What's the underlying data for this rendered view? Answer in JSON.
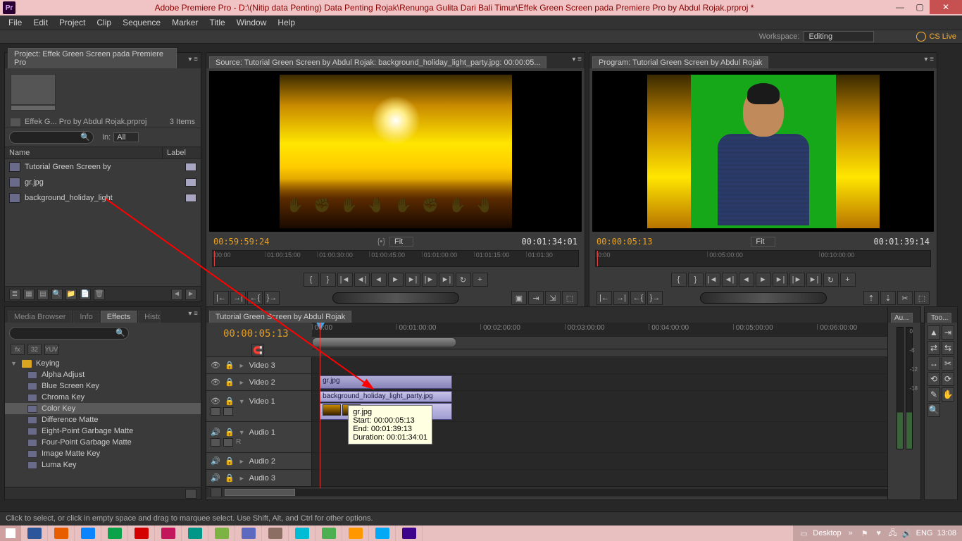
{
  "app": {
    "icon_label": "Pr",
    "title": "Adobe Premiere Pro - D:\\(Nitip data Penting) Data Penting Rojak\\Renunga Gulita Dari Bali Timur\\Effek Green Screen pada Premiere Pro by Abdul Rojak.prproj *"
  },
  "window_buttons": {
    "min": "—",
    "max": "▢",
    "close": "✕"
  },
  "menu": [
    "File",
    "Edit",
    "Project",
    "Clip",
    "Sequence",
    "Marker",
    "Title",
    "Window",
    "Help"
  ],
  "workspace": {
    "label": "Workspace:",
    "value": "Editing",
    "cslive": "CS Live"
  },
  "project_panel": {
    "tab": "Project: Effek Green Screen pada Premiere Pro",
    "file_line": "Effek G... Pro by Abdul Rojak.prproj",
    "item_count": "3 Items",
    "in_label": "In:",
    "in_value": "All",
    "cols": {
      "name": "Name",
      "label": "Label"
    },
    "rows": [
      {
        "name": "Tutorial Green Screen by"
      },
      {
        "name": "gr.jpg"
      },
      {
        "name": "background_holiday_light"
      }
    ]
  },
  "source_monitor": {
    "tab": "Source: Tutorial Green Screen by Abdul Rojak: background_holiday_light_party.jpg: 00:00:05...",
    "tc_left": "00:59:59:24",
    "fit": "Fit",
    "tc_right": "00:01:34:01",
    "ruler": [
      "00:00",
      "01:00:15:00",
      "01:00:30:00",
      "01:00:45:00",
      "01:01:00:00",
      "01:01:15:00",
      "01:01:30"
    ]
  },
  "program_monitor": {
    "tab": "Program: Tutorial Green Screen by Abdul Rojak",
    "tc_left": "00:00:05:13",
    "fit": "Fit",
    "tc_right": "00:01:39:14",
    "ruler": [
      "0:00",
      "00:05:00:00",
      "00:10:00:00"
    ]
  },
  "lower_tabs": {
    "tabs": [
      "Media Browser",
      "Info",
      "Effects",
      "History"
    ],
    "active": "Effects",
    "folder": "Keying",
    "items": [
      "Alpha Adjust",
      "Blue Screen Key",
      "Chroma Key",
      "Color Key",
      "Difference Matte",
      "Eight-Point Garbage Matte",
      "Four-Point Garbage Matte",
      "Image Matte Key",
      "Luma Key"
    ],
    "selected": "Color Key",
    "icons": [
      "fx",
      "32",
      "YUV"
    ]
  },
  "timeline": {
    "tab": "Tutorial Green Screen by Abdul Rojak",
    "playhead_tc": "00:00:05:13",
    "ruler": [
      "00:00",
      "00:01:00:00",
      "00:02:00:00",
      "00:03:00:00",
      "00:04:00:00",
      "00:05:00:00",
      "00:06:00:00"
    ],
    "tracks_video": [
      "Video 3",
      "Video 2",
      "Video 1"
    ],
    "tracks_audio": [
      "Audio 1",
      "Audio 2",
      "Audio 3"
    ],
    "clips": {
      "v2": "gr.jpg",
      "v1": "background_holiday_light_party.jpg"
    },
    "tooltip": {
      "name": "gr.jpg",
      "start": "Start: 00:00:05:13",
      "end": "End: 00:01:39:13",
      "dur": "Duration: 00:01:34:01"
    }
  },
  "meters": {
    "title": "Au...",
    "labels": [
      "0",
      "-6",
      "-12",
      "-18"
    ]
  },
  "tools": {
    "title": "Too..."
  },
  "status": "Click to select, or click in empty space and drag to marquee select. Use Shift, Alt, and Ctrl for other options.",
  "taskbar": {
    "desktop": "Desktop",
    "lang": "ENG",
    "clock": "13:08",
    "apps": [
      "#2b579a",
      "#e85d00",
      "#0a84ff",
      "#0aa34a",
      "#d40000",
      "#c2185b",
      "#009688",
      "#7cb342",
      "#5c6bc0",
      "#8d6e63",
      "#00bcd4",
      "#4caf50",
      "#ff9800",
      "#03a9f4",
      "#3f048c"
    ]
  },
  "transport_glyphs": {
    "in": "{",
    "out": "}",
    "gostart": "|◄",
    "stepback": "◄|",
    "back": "◄",
    "play": "►",
    "fwd": "►|",
    "stepfwd": "|►",
    "goend": "►|",
    "loop": "↻",
    "more": "+"
  }
}
